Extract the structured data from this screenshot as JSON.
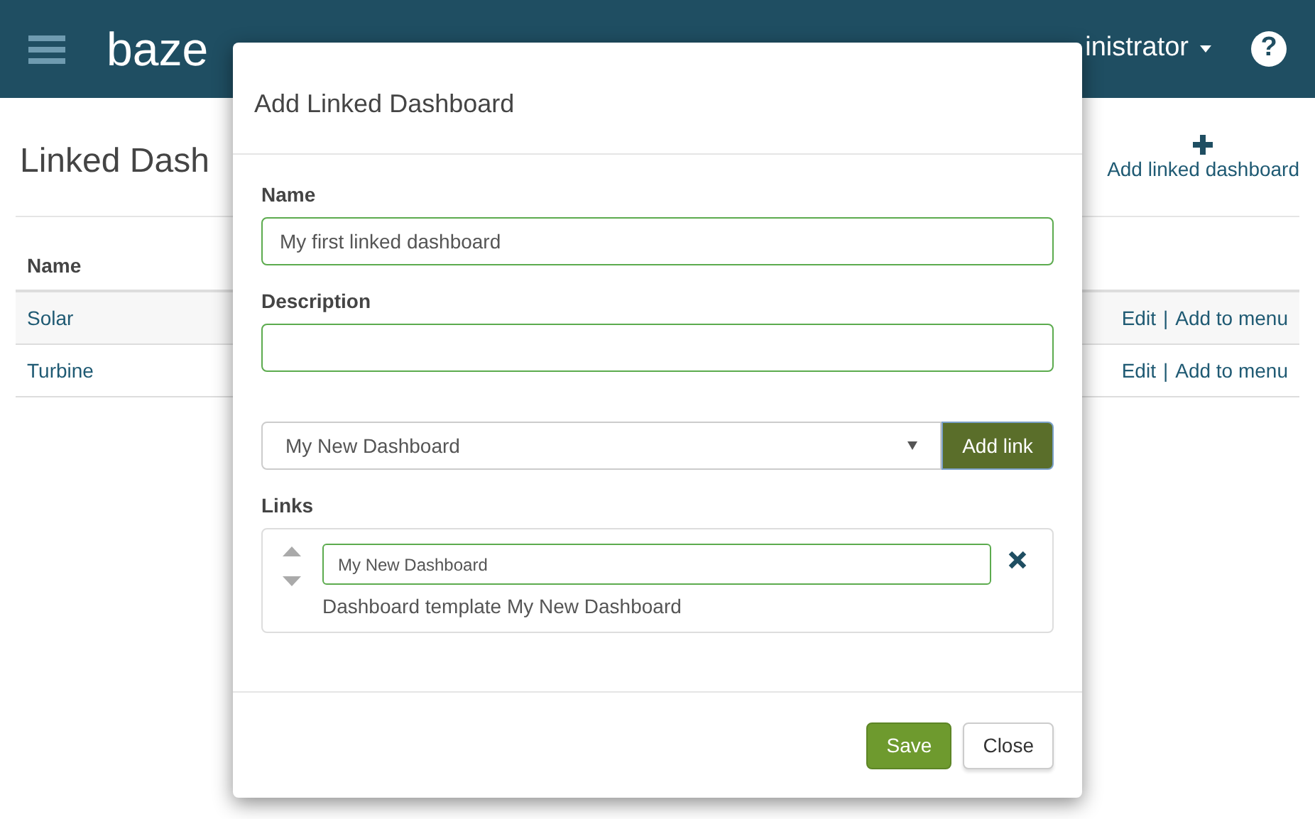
{
  "header": {
    "logo": "baze",
    "user": "inistrator",
    "help": "?"
  },
  "page": {
    "title": "Linked Dash",
    "add_action": "Add linked dashboard"
  },
  "table": {
    "columns": [
      "Name"
    ],
    "rows": [
      {
        "name": "Solar",
        "actions": [
          "Edit",
          "|",
          "Add to menu"
        ]
      },
      {
        "name": "Turbine",
        "actions": [
          "Edit",
          "|",
          "Add to menu"
        ]
      }
    ]
  },
  "modal": {
    "title": "Add Linked Dashboard",
    "name_label": "Name",
    "name_value": "My first linked dashboard",
    "description_label": "Description",
    "select_value": "My New Dashboard",
    "add_link_button": "Add link",
    "links_label": "Links",
    "links": [
      {
        "value": "My New Dashboard",
        "description": "Dashboard template My New Dashboard"
      }
    ],
    "buttons": [
      {
        "label": "Save",
        "kind": "primary"
      },
      {
        "label": "Close",
        "kind": "default"
      }
    ]
  }
}
